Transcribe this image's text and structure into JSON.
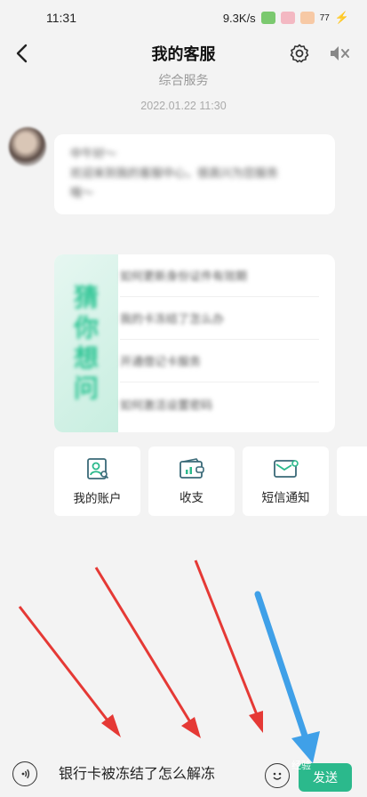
{
  "status_bar": {
    "time": "11:31",
    "network_speed": "9.3K/s",
    "battery": "77"
  },
  "header": {
    "title": "我的客服",
    "back_icon": "chevron-left-icon",
    "settings_icon": "gear-icon",
    "mute_icon": "speaker-mute-icon"
  },
  "chat": {
    "category": "综合服务",
    "timestamp": "2022.01.22 11:30",
    "greeting_lines": [
      "中午好～",
      "欢迎来到我的客服中心，很高兴为您服务",
      "哦～"
    ]
  },
  "guess_card": {
    "title_chars": [
      "猜",
      "你",
      "想",
      "问"
    ],
    "questions": [
      "如何更新身份证件有效期",
      "我的卡冻结了怎么办",
      "开通借记卡服务",
      "如何激活设置密码"
    ]
  },
  "shortcuts": [
    {
      "label": "我的账户",
      "icon": "account-search-icon"
    },
    {
      "label": "收支",
      "icon": "wallet-chart-icon"
    },
    {
      "label": "短信通知",
      "icon": "sms-envelope-icon"
    }
  ],
  "input_bar": {
    "value": "银行卡被冻结了怎么解冻",
    "send_label": "发送",
    "voice_icon": "voice-icon",
    "emoji_icon": "emoji-icon"
  },
  "watermark": "经验"
}
